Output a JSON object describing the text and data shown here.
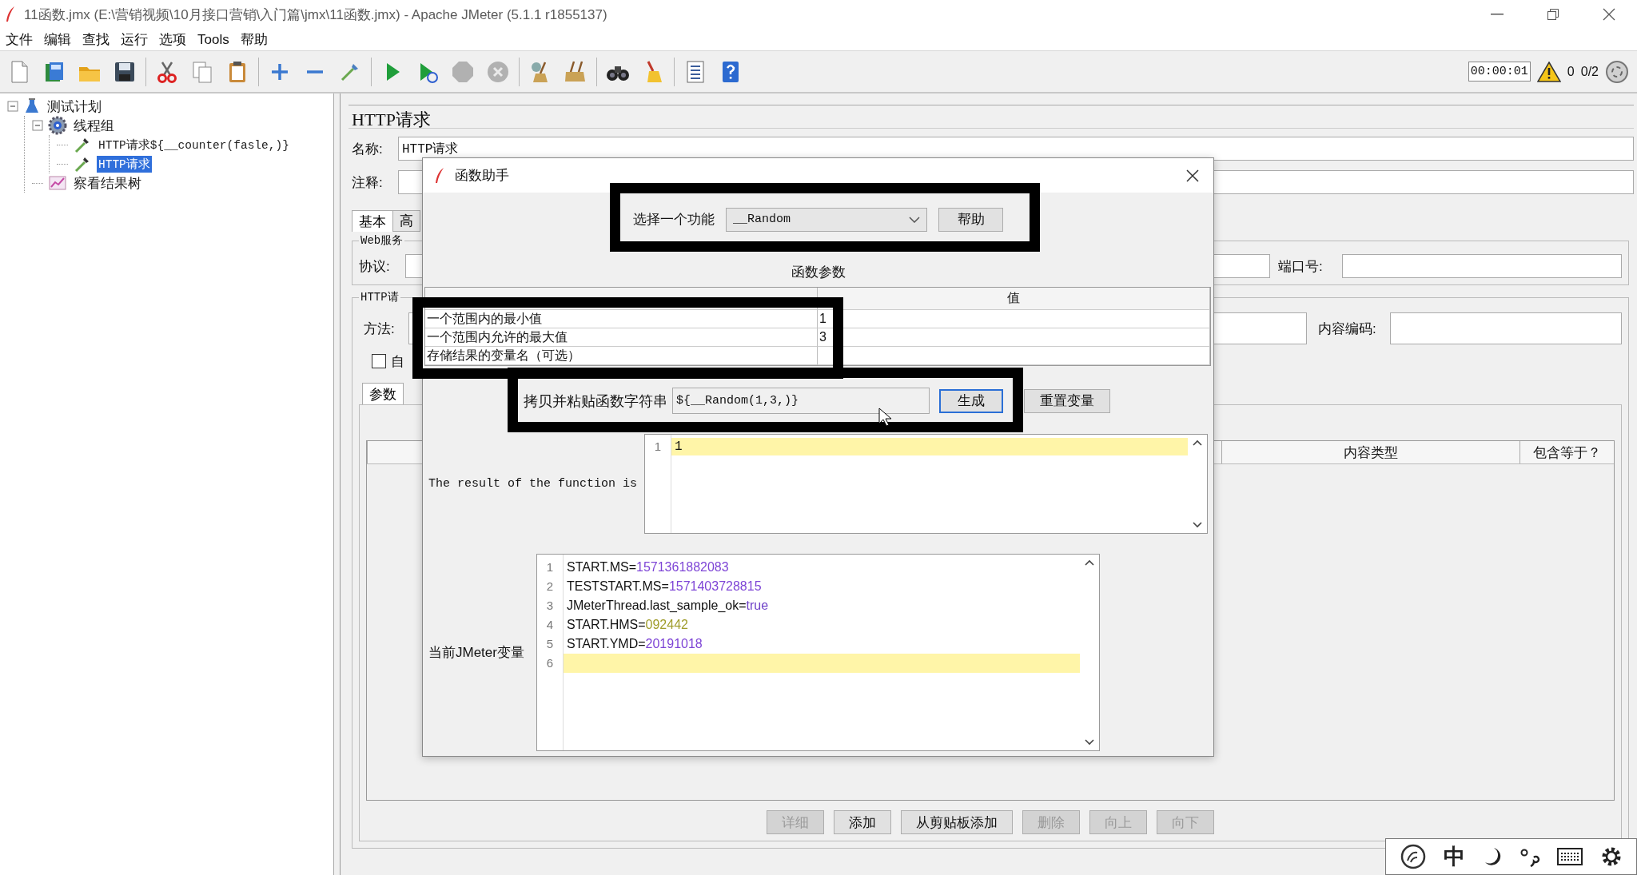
{
  "window": {
    "title": "11函数.jmx (E:\\营销视频\\10月接口营销\\入门篇\\jmx\\11函数.jmx) - Apache JMeter (5.1.1 r1855137)"
  },
  "menu": [
    "文件",
    "编辑",
    "查找",
    "运行",
    "选项",
    "Tools",
    "帮助"
  ],
  "toolbar": {
    "groups": [
      [
        {
          "disabled": false
        },
        {
          "disabled": false
        },
        {
          "disabled": false
        },
        {
          "disabled": false
        }
      ],
      [
        {
          "disabled": false
        },
        {
          "disabled": false
        },
        {
          "disabled": false
        }
      ],
      [
        {
          "disabled": false
        },
        {
          "disabled": false
        },
        {
          "disabled": false
        }
      ],
      [
        {
          "disabled": false
        },
        {
          "disabled": false
        },
        {
          "disabled": true
        },
        {
          "disabled": true
        }
      ],
      [
        {
          "disabled": false
        },
        {
          "disabled": false
        }
      ],
      [
        {
          "disabled": false
        },
        {
          "disabled": false
        }
      ],
      [
        {
          "disabled": false
        },
        {
          "disabled": false
        }
      ]
    ],
    "timer": "00:00:01",
    "warnings": "0",
    "threads": "0/2"
  },
  "tree": [
    {
      "label": "测试计划",
      "kind": "plan",
      "expanded": true,
      "selected": false,
      "children": [
        {
          "label": "线程组",
          "kind": "thread-group",
          "expanded": true,
          "selected": false,
          "children": [
            {
              "label": "HTTP请求${__counter(fasle,)}",
              "kind": "sampler",
              "selected": false
            },
            {
              "label": "HTTP请求",
              "kind": "sampler",
              "selected": true
            }
          ]
        },
        {
          "label": "察看结果树",
          "kind": "listener",
          "selected": false
        }
      ]
    }
  ],
  "editor": {
    "title": "HTTP请求",
    "name_label": "名称:",
    "name_value": "HTTP请求",
    "comment_label": "注释:",
    "tabs": [
      {
        "label": "基本",
        "selected": true
      },
      {
        "label": "高",
        "selected": false
      }
    ],
    "web_server": {
      "legend": "Web服务",
      "protocol_label": "协议:",
      "port_label": "端口号:"
    },
    "http_request": {
      "legend": "HTTP请",
      "method_label": "方法:",
      "encoding_label": "内容编码:",
      "checkbox": {
        "label": "自",
        "checked": false
      },
      "tabs": [
        {
          "label": "参数",
          "selected": true
        }
      ],
      "table": {
        "columns": [
          "内容类型",
          "包含等于？"
        ]
      },
      "buttons": [
        {
          "label": "详细",
          "disabled": true
        },
        {
          "label": "添加",
          "disabled": false
        },
        {
          "label": "从剪贴板添加",
          "disabled": false
        },
        {
          "label": "删除",
          "disabled": true
        },
        {
          "label": "向上",
          "disabled": true
        },
        {
          "label": "向下",
          "disabled": true
        }
      ]
    }
  },
  "dialog": {
    "title": "函数助手",
    "function_label": "选择一个功能",
    "function_value": "__Random",
    "help_button": "帮助",
    "params_title": "函数参数",
    "value_header": "值",
    "params": [
      {
        "name": "一个范围内的最小值",
        "value": "1"
      },
      {
        "name": "一个范围内允许的最大值",
        "value": "3"
      },
      {
        "name": "存储结果的变量名（可选）"
      }
    ],
    "copy_label": "拷贝并粘贴函数字符串",
    "function_string": "${__Random(1,3,)}",
    "generate_button": {
      "label": "生成",
      "focused": true
    },
    "reset_button": "重置变量",
    "result_label": "The result of the function is",
    "result_lines": [
      {
        "number": "1",
        "text": "1",
        "current": true
      }
    ],
    "variables_label": "当前JMeter变量",
    "variable_lines": [
      {
        "number": "1",
        "key": "START.MS=",
        "value": "1571361882083",
        "kind": "number",
        "current": false
      },
      {
        "number": "2",
        "key": "TESTSTART.MS=",
        "value": "1571403728815",
        "kind": "number",
        "current": false
      },
      {
        "number": "3",
        "key": "JMeterThread.last_sample_ok=",
        "value": "true",
        "kind": "boolean",
        "current": false
      },
      {
        "number": "4",
        "key": "START.HMS=",
        "value": "092442",
        "kind": "literal",
        "current": false
      },
      {
        "number": "5",
        "key": "START.YMD=",
        "value": "20191018",
        "kind": "number",
        "current": false
      },
      {
        "number": "6",
        "current": true
      }
    ]
  },
  "ime": {
    "mode": "中"
  }
}
